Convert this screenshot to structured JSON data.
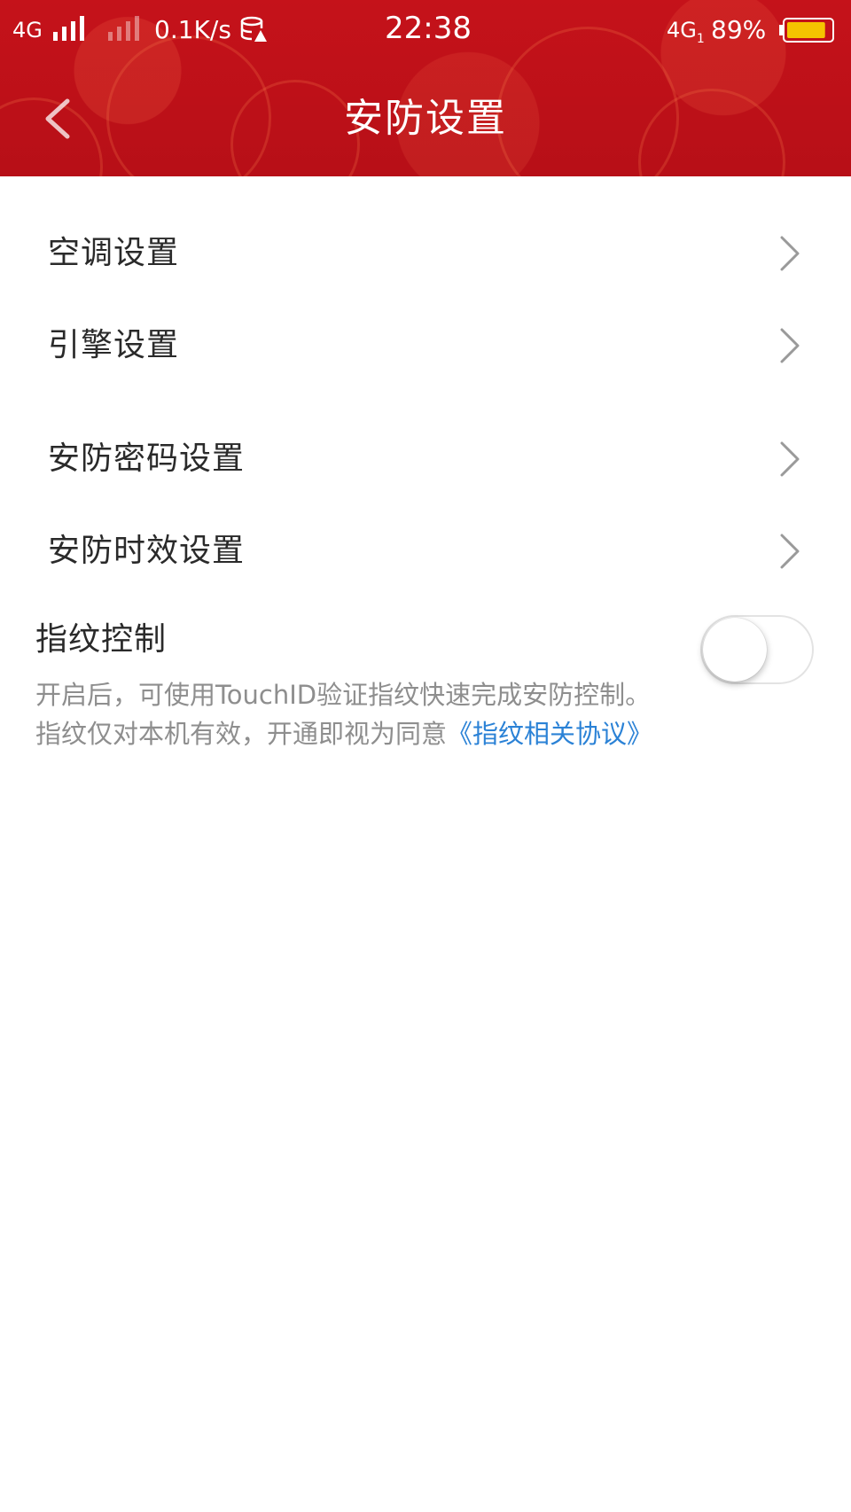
{
  "status_bar": {
    "carrier_left": "4G",
    "net_speed": "0.1K/s",
    "time": "22:38",
    "carrier_right": "4G",
    "carrier_right_sub": "1",
    "battery_percent": "89%",
    "battery_level": 0.89,
    "battery_color": "#f5c400"
  },
  "header": {
    "title": "安防设置",
    "back_icon": "chevron-left-icon",
    "background_color": "#c5121a"
  },
  "settings": {
    "items": [
      {
        "label": "空调设置",
        "icon": "chevron-right-icon"
      },
      {
        "label": "引擎设置",
        "icon": "chevron-right-icon"
      },
      {
        "label": "安防密码设置",
        "icon": "chevron-right-icon"
      },
      {
        "label": "安防时效设置",
        "icon": "chevron-right-icon"
      }
    ]
  },
  "fingerprint": {
    "title": "指纹控制",
    "enabled": false,
    "description_line1": "开启后，可使用TouchID验证指纹快速完成安防控制。",
    "description_line2": "指纹仅对本机有效，开通即视为同意",
    "agreement_link": "《指纹相关协议》",
    "link_color": "#2b82d6"
  }
}
